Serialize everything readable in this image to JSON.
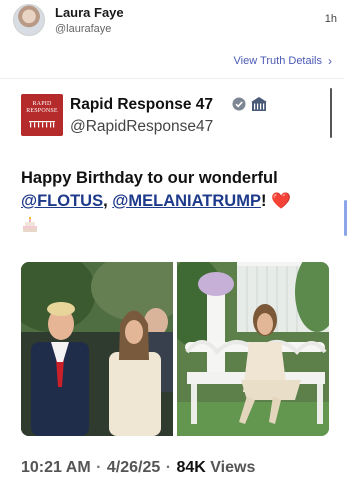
{
  "post": {
    "author_name": "Laura Faye",
    "author_handle": "@laurafaye",
    "time": "1h",
    "view_truth_label": "View Truth Details"
  },
  "embedded": {
    "name": "Rapid Response 47",
    "handle": "@RapidResponse47",
    "logo_line1": "RAPID",
    "logo_line2": "RESPONSE",
    "text_before": "Happy Birthday to our wonderful",
    "mention1": "@FLOTUS",
    "separator": ",",
    "mention2": "@MELANIATRUMP",
    "text_after": "!",
    "heart": "❤️",
    "cake_icon": "birthday-cake-icon",
    "timestamp": "10:21 AM",
    "date": "4/26/25",
    "views_count": "84K",
    "views_label": "Views"
  },
  "colors": {
    "logo_red": "#b52a2a",
    "link_purple": "#4b5ab5",
    "mention_blue": "#1e3a8a",
    "verified_gray": "#7d8794"
  }
}
